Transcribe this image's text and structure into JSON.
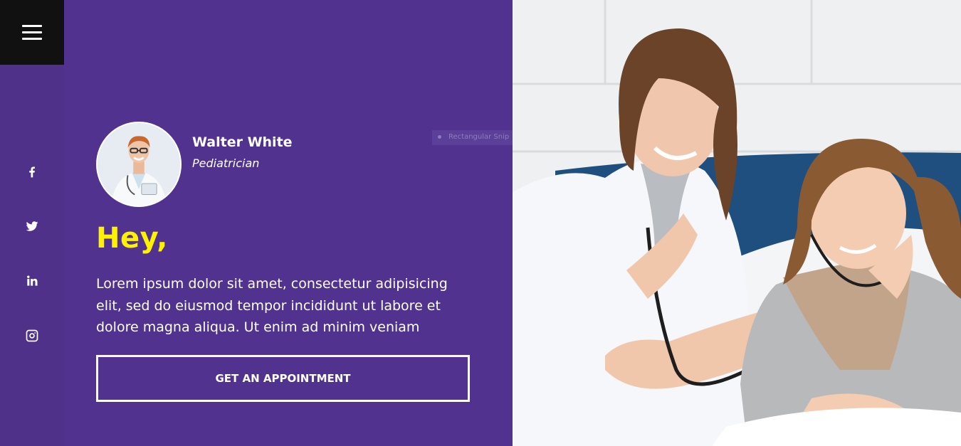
{
  "menu": {
    "icon": "hamburger-icon"
  },
  "social": [
    {
      "name": "facebook-icon"
    },
    {
      "name": "twitter-icon"
    },
    {
      "name": "linkedin-icon"
    },
    {
      "name": "instagram-icon"
    }
  ],
  "profile": {
    "name": "Walter White",
    "role": "Pediatrician"
  },
  "tooltip": {
    "label": "Rectangular Snip"
  },
  "hero": {
    "greeting": "Hey,",
    "description": "Lorem ipsum dolor sit amet, consectetur adipisicing elit, sed do eiusmod tempor incididunt ut labore et dolore magna aliqua. Ut enim ad minim veniam",
    "cta_label": "GET AN APPOINTMENT"
  },
  "colors": {
    "panel": "#52328f",
    "accent": "#fff200",
    "menu_bg": "#111111"
  }
}
